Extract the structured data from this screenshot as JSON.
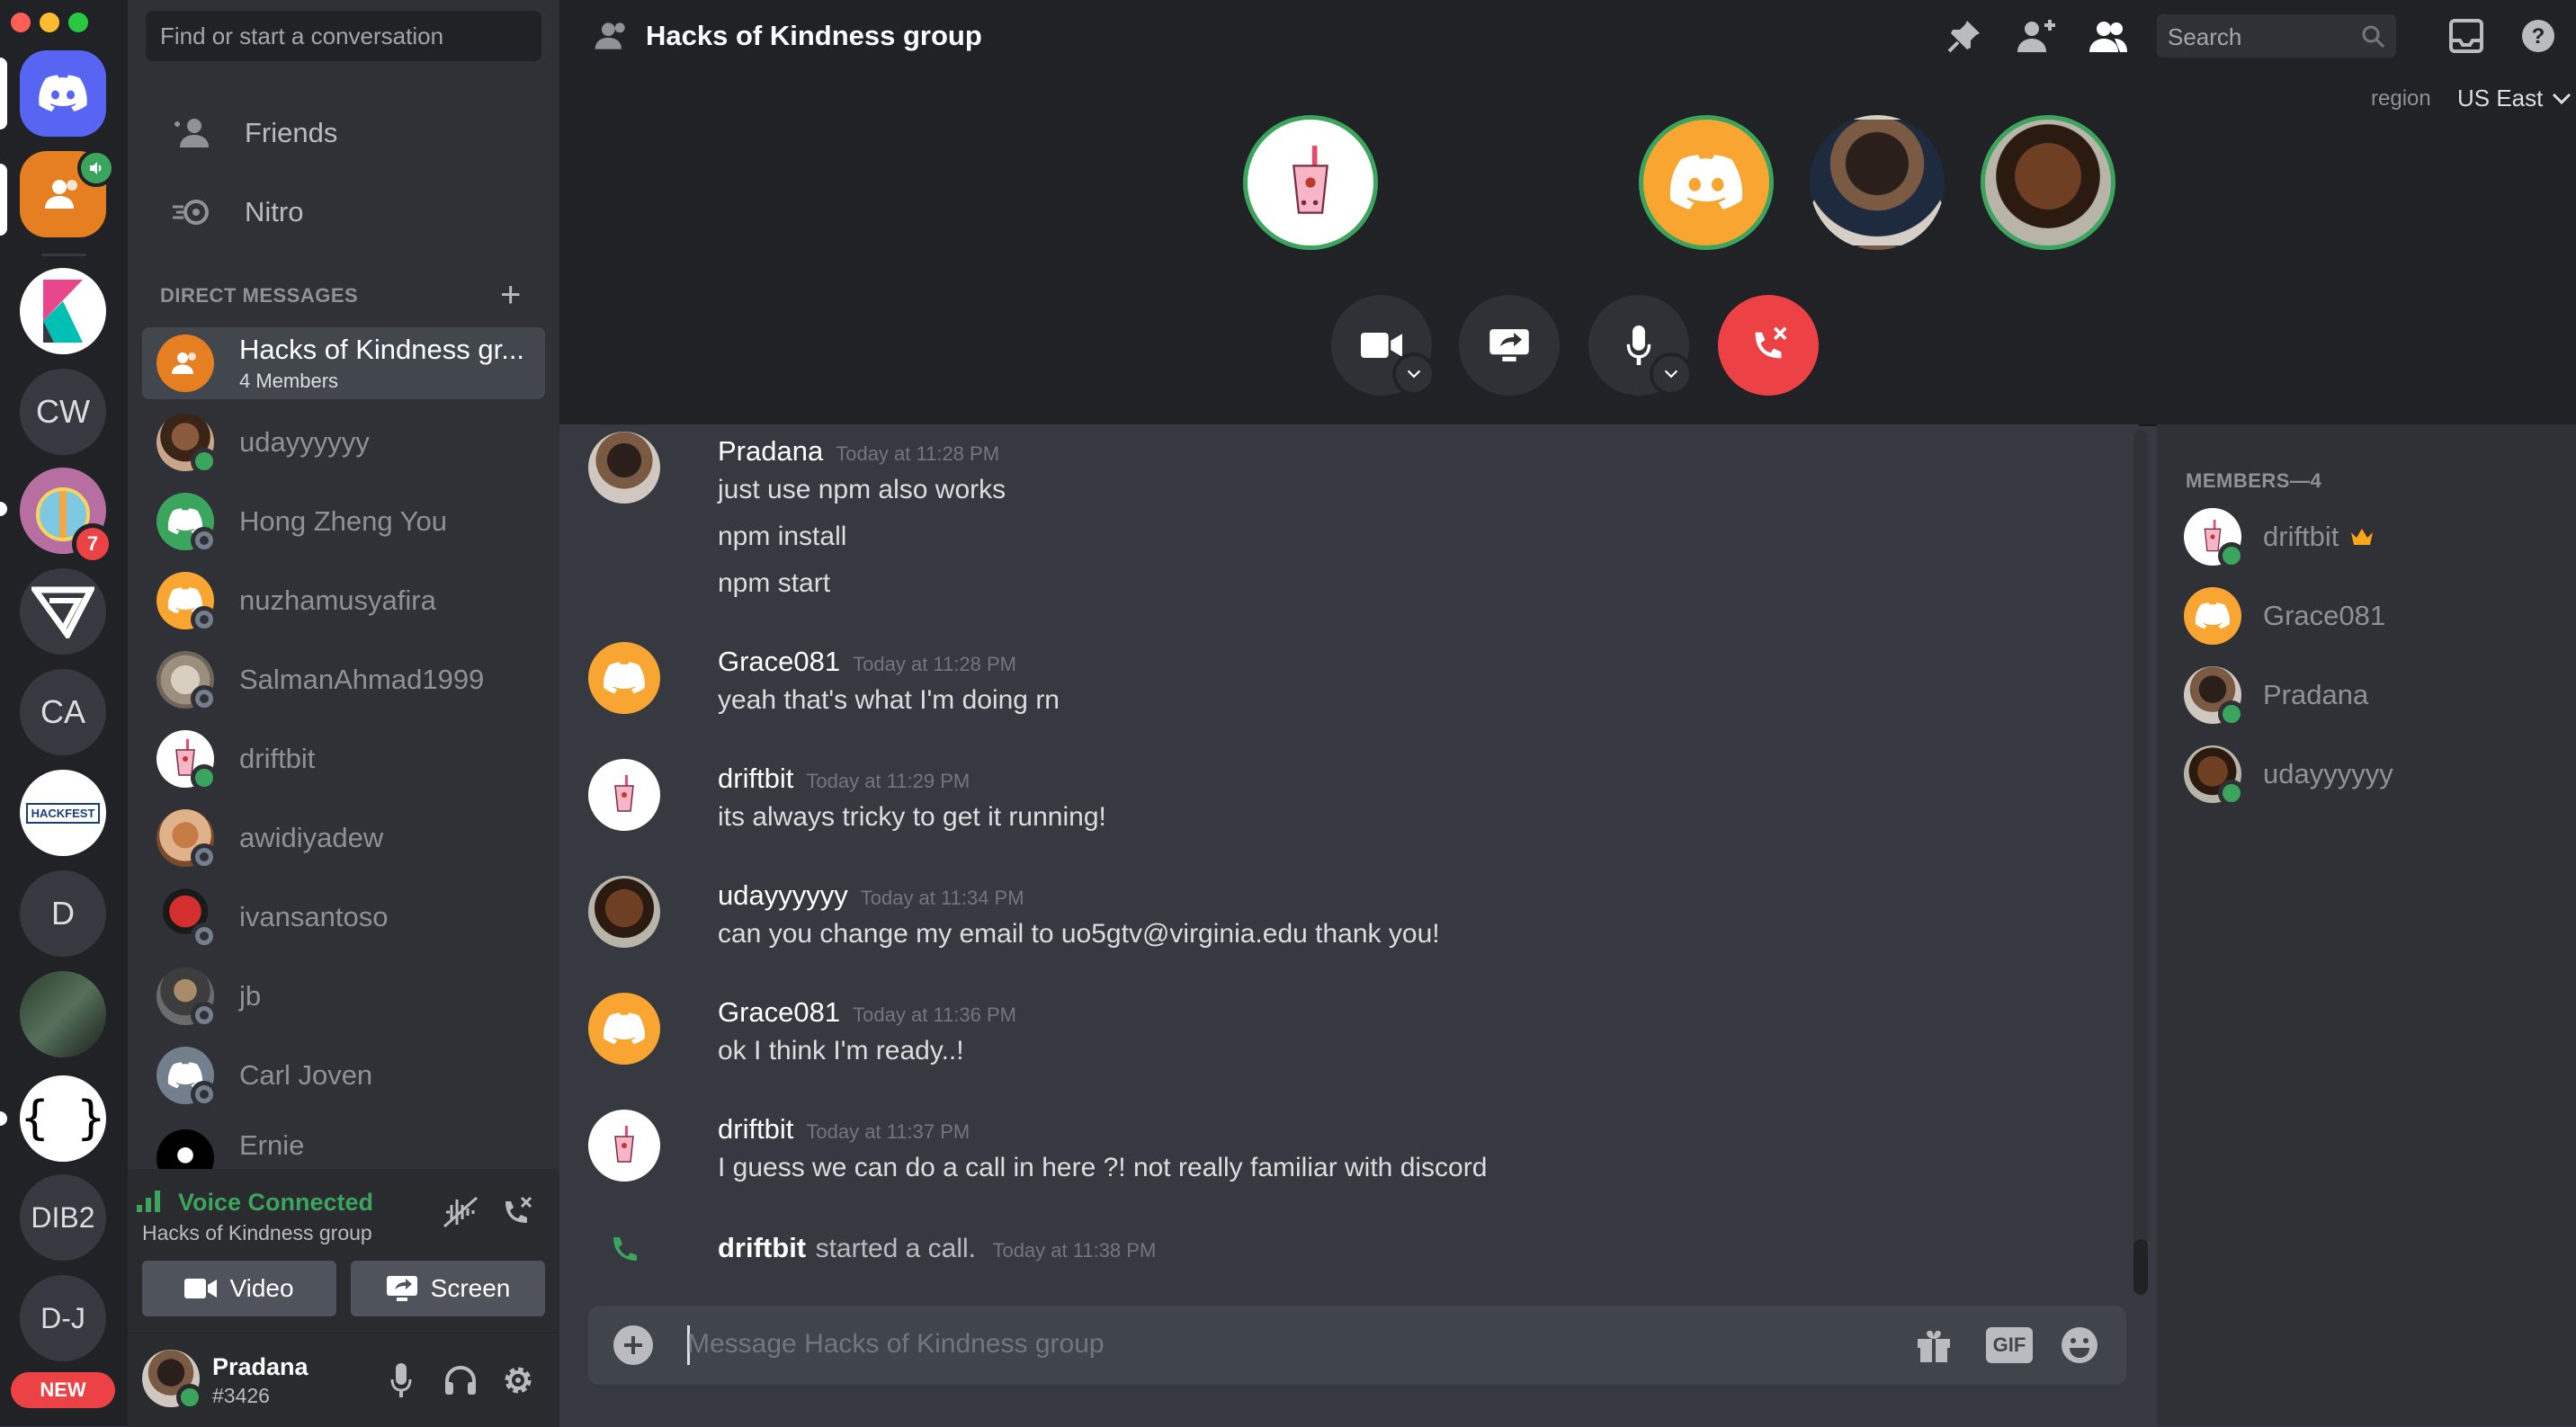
{
  "colors": {
    "accent": "#5865f2",
    "online": "#3ba55d",
    "danger": "#ed4245",
    "orange": "#f8a532",
    "group_orange": "#e67e22"
  },
  "rail": {
    "servers": [
      {
        "name": "home",
        "label": "",
        "icon": "discord-icon"
      },
      {
        "name": "group-dm",
        "label": "",
        "icon": "group-icon"
      },
      {
        "name": "k-server",
        "label": "",
        "icon": "k-logo-icon"
      },
      {
        "name": "cw-server",
        "label": "CW"
      },
      {
        "name": "hacks-kindness-server",
        "label": "",
        "badge": "7"
      },
      {
        "name": "v-server",
        "label": "",
        "icon": "v-logo-icon"
      },
      {
        "name": "ca-server",
        "label": "CA"
      },
      {
        "name": "hackfest-server",
        "label": "HACKFEST"
      },
      {
        "name": "d-server",
        "label": "D"
      },
      {
        "name": "photo-server",
        "label": ""
      },
      {
        "name": "braces-server",
        "label": "{ }"
      },
      {
        "name": "dib2-server",
        "label": "DIB2"
      },
      {
        "name": "dj-server",
        "label": "D-J"
      }
    ],
    "new_badge": "NEW"
  },
  "sidebar": {
    "search_placeholder": "Find or start a conversation",
    "nav": [
      {
        "label": "Friends",
        "icon": "friends-icon"
      },
      {
        "label": "Nitro",
        "icon": "nitro-icon"
      }
    ],
    "dm_header": "DIRECT MESSAGES",
    "dms": [
      {
        "name": "Hacks of Kindness gr...",
        "sub": "4 Members",
        "status": "none",
        "active": true
      },
      {
        "name": "udayyyyyy",
        "status": "online"
      },
      {
        "name": "Hong Zheng You",
        "status": "offline"
      },
      {
        "name": "nuzhamusyafira",
        "status": "offline"
      },
      {
        "name": "SalmanAhmad1999",
        "status": "offline"
      },
      {
        "name": "driftbit",
        "status": "online"
      },
      {
        "name": "awidiyadew",
        "status": "offline"
      },
      {
        "name": "ivansantoso",
        "status": "offline"
      },
      {
        "name": "jb",
        "status": "offline"
      },
      {
        "name": "Carl Joven",
        "status": "offline"
      },
      {
        "name": "Ernie",
        "status": "none"
      }
    ],
    "voice": {
      "status": "Voice Connected",
      "channel": "Hacks of Kindness group",
      "video_label": "Video",
      "screen_label": "Screen"
    },
    "user": {
      "name": "Pradana",
      "tag": "#3426"
    }
  },
  "header": {
    "title": "Hacks of Kindness group",
    "search_placeholder": "Search",
    "region_label": "region",
    "region_value": "US East"
  },
  "messages": [
    {
      "author": "Pradana",
      "time": "Today at 11:28 PM",
      "lines": [
        "just use npm also works",
        "npm install",
        "npm start"
      ]
    },
    {
      "author": "Grace081",
      "time": "Today at 11:28 PM",
      "lines": [
        "yeah that's what I'm doing rn"
      ]
    },
    {
      "author": "driftbit",
      "time": "Today at 11:29 PM",
      "lines": [
        "its always tricky to get it running!"
      ]
    },
    {
      "author": "udayyyyyy",
      "time": "Today at 11:34 PM",
      "lines": [
        "can you change my email to uo5gtv@virginia.edu thank you!"
      ]
    },
    {
      "author": "Grace081",
      "time": "Today at 11:36 PM",
      "lines": [
        "ok I think I'm ready..!"
      ]
    },
    {
      "author": "driftbit",
      "time": "Today at 11:37 PM",
      "lines": [
        "I guess we can do a call in here ?! not really familiar with discord"
      ]
    }
  ],
  "system_message": {
    "author": "driftbit",
    "text": "started a call.",
    "time": "Today at 11:38 PM"
  },
  "composer": {
    "placeholder": "Message Hacks of Kindness group",
    "gif_label": "GIF"
  },
  "members": {
    "header": "MEMBERS—4",
    "list": [
      {
        "name": "driftbit",
        "owner": true,
        "status": "online"
      },
      {
        "name": "Grace081",
        "owner": false,
        "status": "none"
      },
      {
        "name": "Pradana",
        "owner": false,
        "status": "online"
      },
      {
        "name": "udayyyyyy",
        "owner": false,
        "status": "online"
      }
    ]
  }
}
